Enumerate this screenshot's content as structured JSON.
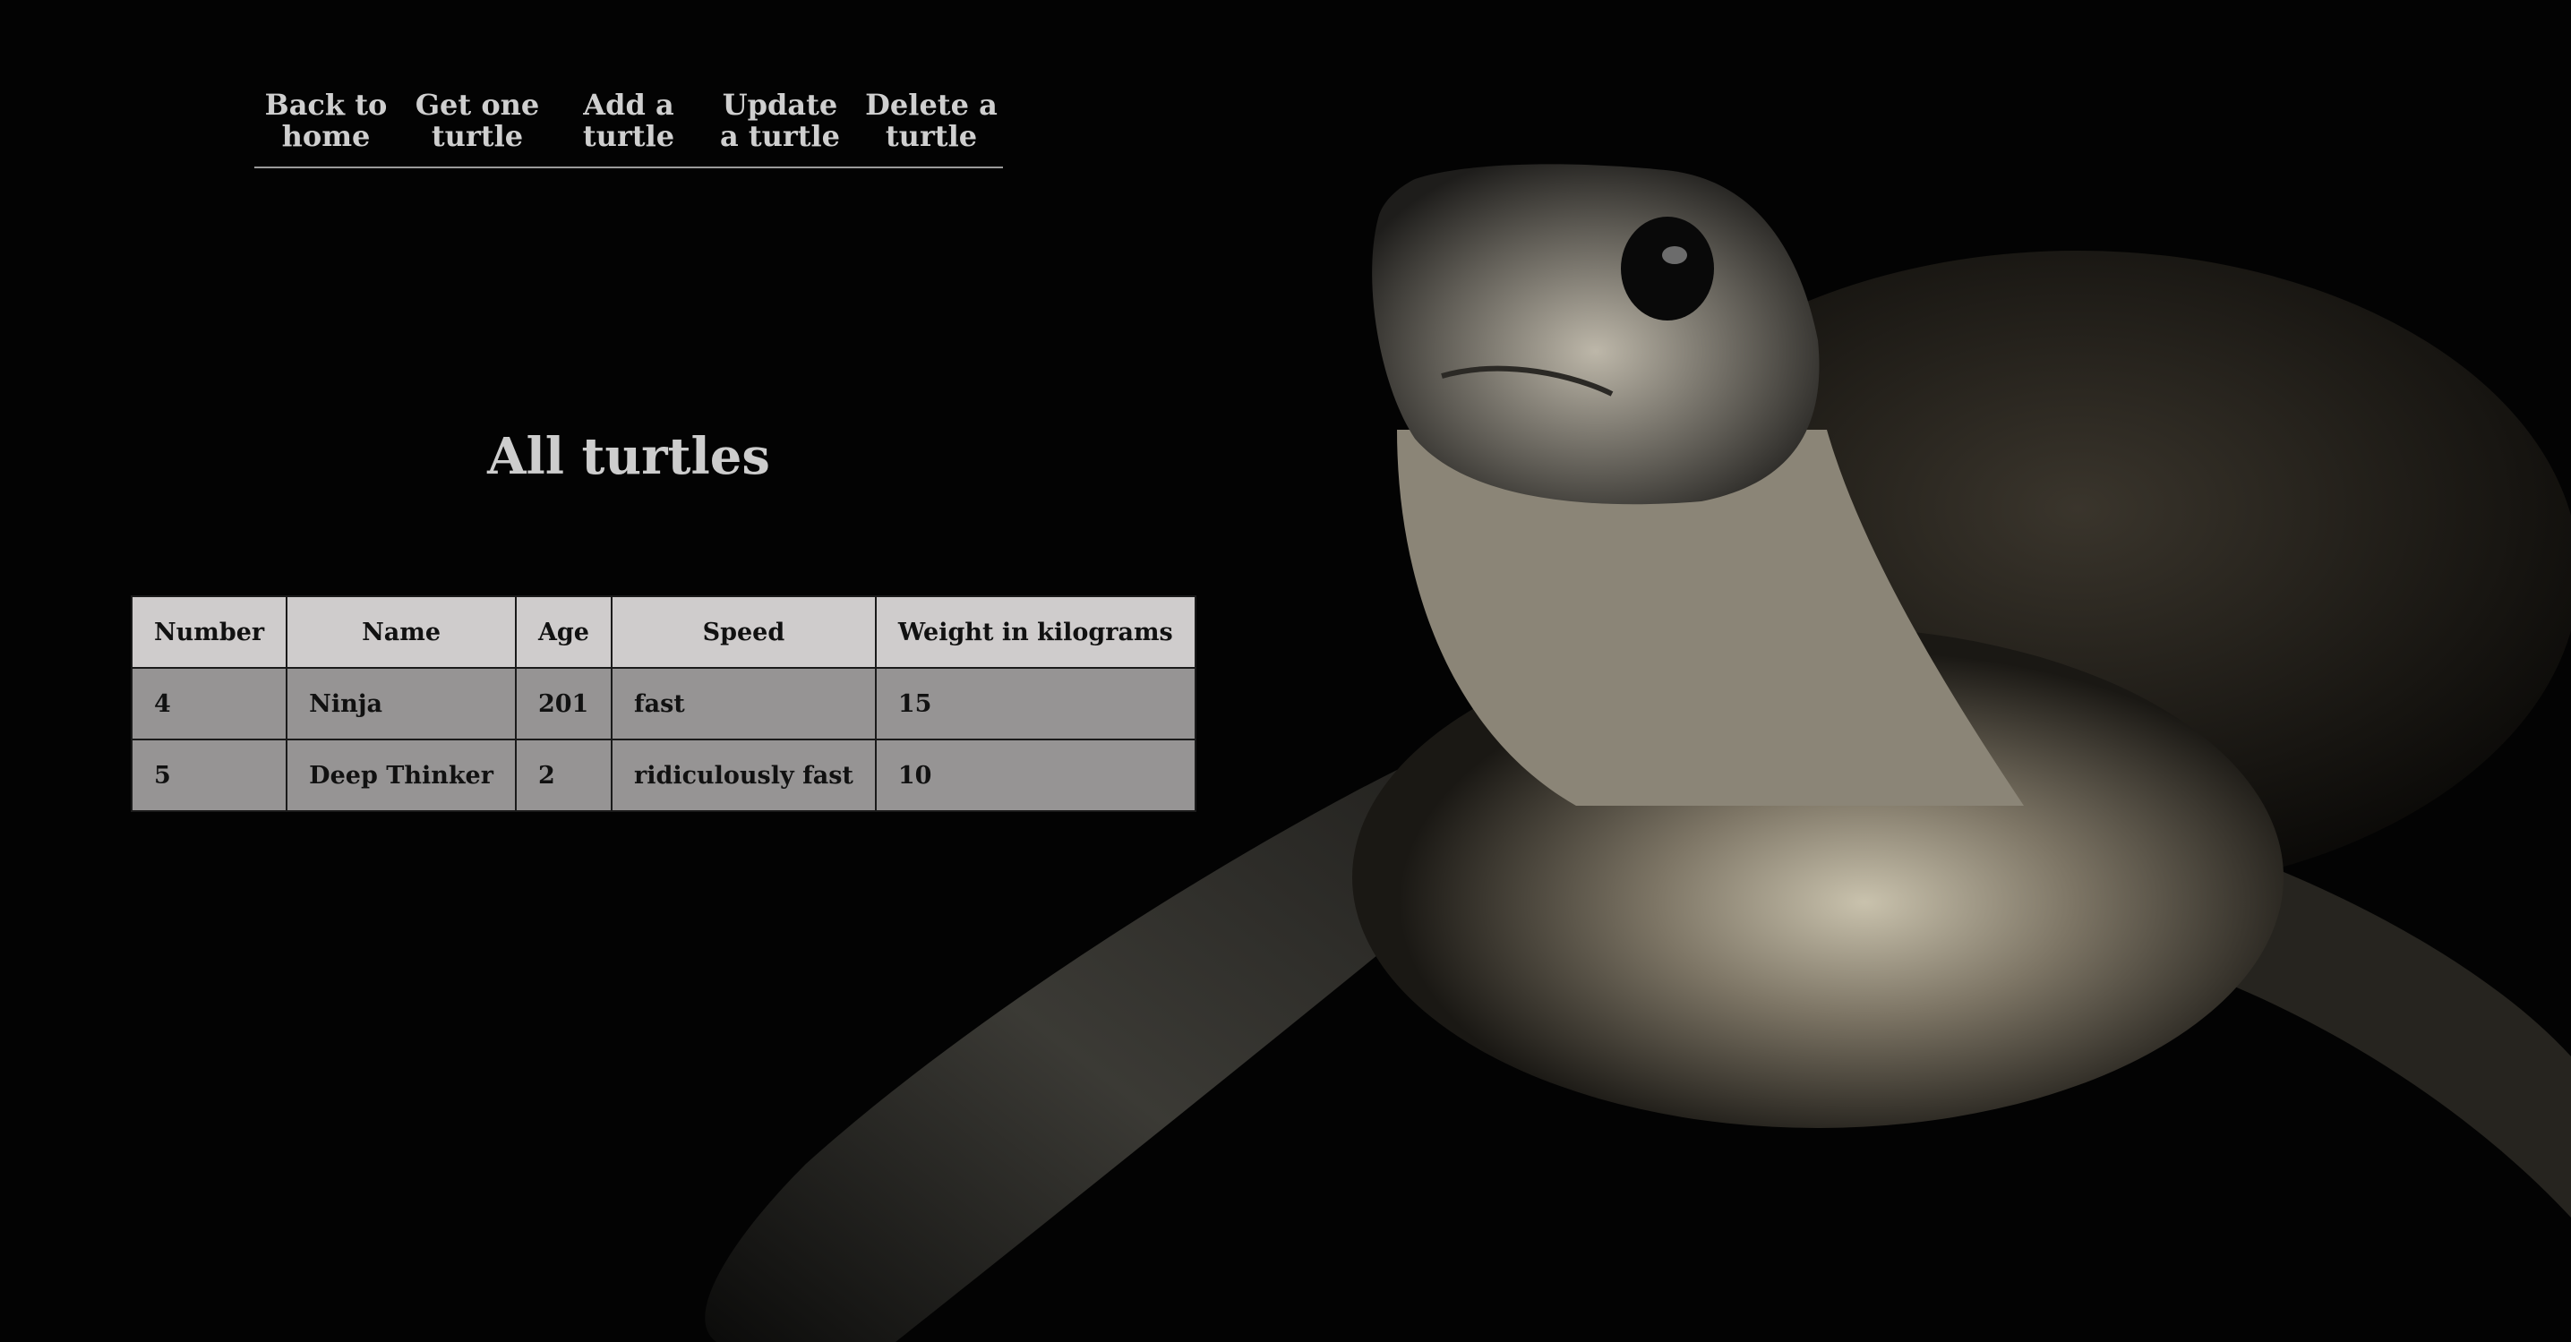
{
  "nav": {
    "links": [
      {
        "line1": "Back to",
        "line2": "home"
      },
      {
        "line1": "Get one",
        "line2": "turtle"
      },
      {
        "line1": "Add a",
        "line2": "turtle"
      },
      {
        "line1": "Update",
        "line2": "a turtle"
      },
      {
        "line1": "Delete a",
        "line2": "turtle"
      }
    ]
  },
  "page": {
    "title": "All turtles",
    "background_image": "sea-turtle-photo"
  },
  "table": {
    "headers": [
      "Number",
      "Name",
      "Age",
      "Speed",
      "Weight in kilograms"
    ],
    "rows": [
      [
        "4",
        "Ninja",
        "201",
        "fast",
        "15"
      ],
      [
        "5",
        "Deep Thinker",
        "2",
        "ridiculously fast",
        "10"
      ]
    ]
  },
  "colors": {
    "background": "#000000",
    "nav_text": "#cfcfcf",
    "header_bg": "#cfcccc",
    "row_bg": "#969494"
  }
}
